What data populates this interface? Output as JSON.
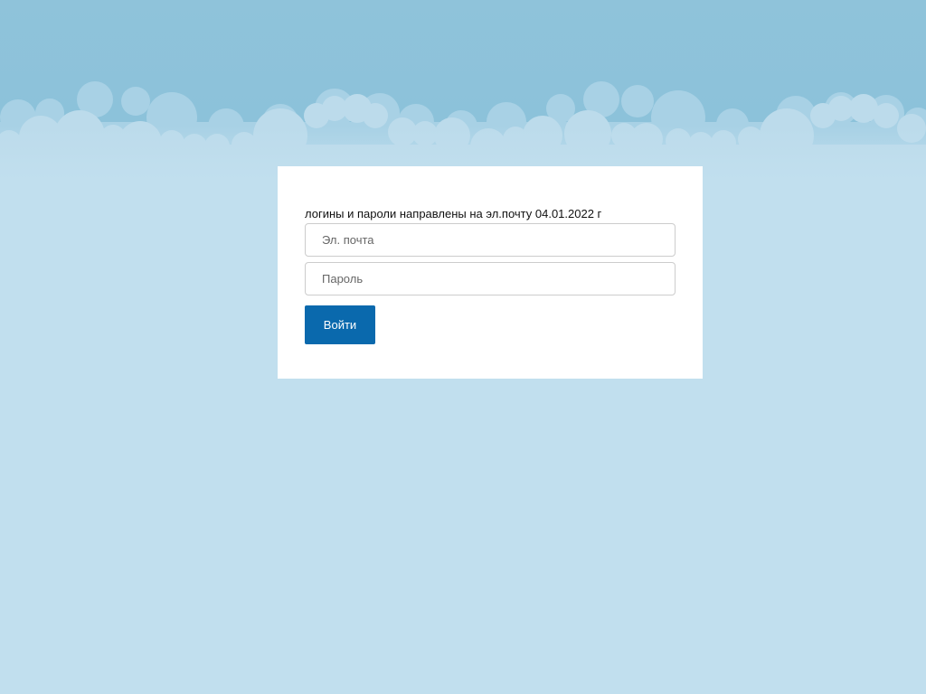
{
  "login": {
    "notice": "логины и пароли направлены на эл.почту 04.01.2022 г",
    "email_placeholder": "Эл. почта",
    "password_placeholder": "Пароль",
    "submit_label": "Войти"
  },
  "colors": {
    "sky_top": "#8fc3da",
    "background": "#c1dfee",
    "button": "#0a69ad"
  }
}
